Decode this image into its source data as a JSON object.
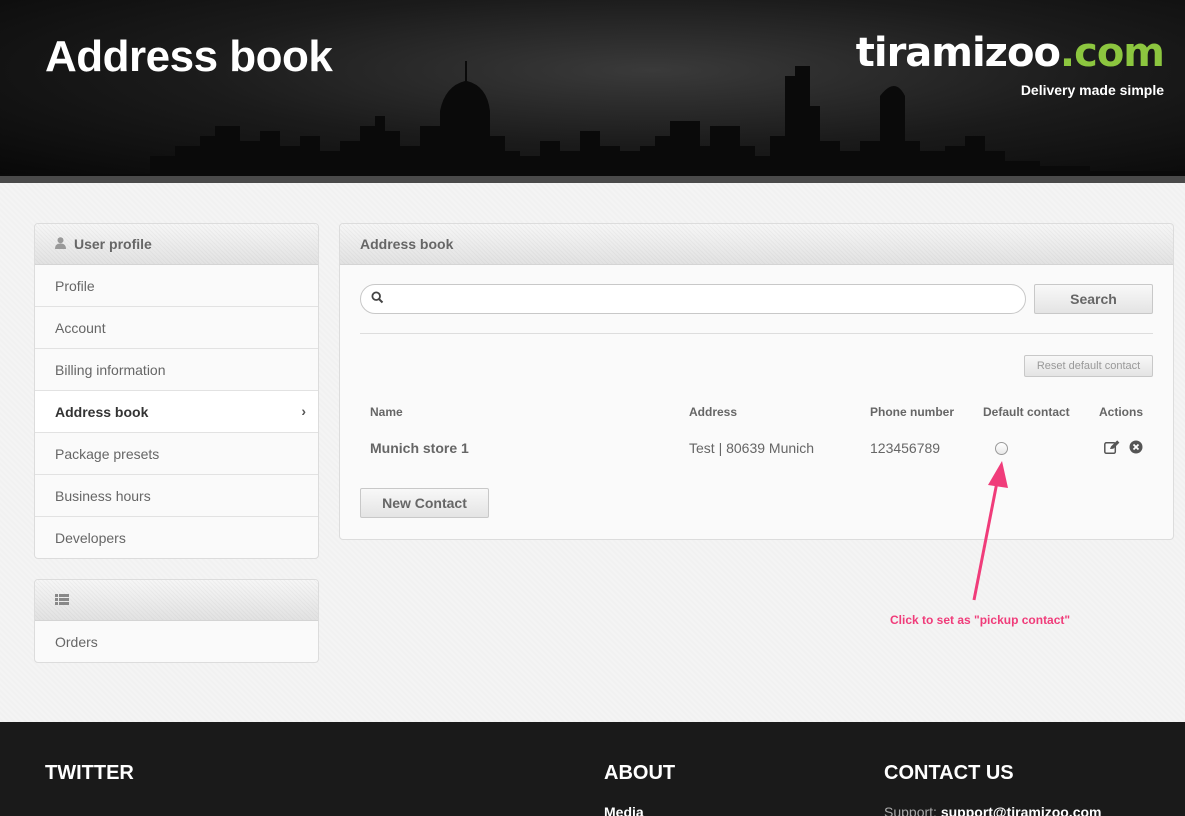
{
  "header": {
    "title": "Address book",
    "logo_main": "tiramizoo",
    "logo_tld": ".com",
    "tagline": "Delivery made simple"
  },
  "sidebar": {
    "profile_section": {
      "title": "User profile",
      "icon": "user-icon",
      "items": [
        {
          "label": "Profile",
          "active": false
        },
        {
          "label": "Account",
          "active": false
        },
        {
          "label": "Billing information",
          "active": false
        },
        {
          "label": "Address book",
          "active": true
        },
        {
          "label": "Package presets",
          "active": false
        },
        {
          "label": "Business hours",
          "active": false
        },
        {
          "label": "Developers",
          "active": false
        }
      ]
    },
    "orders_section": {
      "icon": "list-icon",
      "items": [
        {
          "label": "Orders"
        }
      ]
    }
  },
  "main": {
    "title": "Address book",
    "search": {
      "placeholder": "",
      "value": "",
      "button_label": "Search"
    },
    "reset_label": "Reset default contact",
    "columns": [
      "Name",
      "Address",
      "Phone number",
      "Default contact",
      "Actions"
    ],
    "rows": [
      {
        "name": "Munich store 1",
        "address": "Test | 80639 Munich",
        "phone": "123456789",
        "default": false
      }
    ],
    "new_contact_label": "New Contact",
    "annotation": "Click to set as \"pickup contact\""
  },
  "footer": {
    "twitter_heading": "TWITTER",
    "about_heading": "ABOUT",
    "about_link": "Media",
    "contact_heading": "CONTACT US",
    "support_label": "Support:",
    "support_email": "support@tiramizoo.com"
  },
  "colors": {
    "brand_green": "#8cc63f",
    "annotation_pink": "#f03c7a",
    "footer_bg": "#1a1a1a"
  }
}
